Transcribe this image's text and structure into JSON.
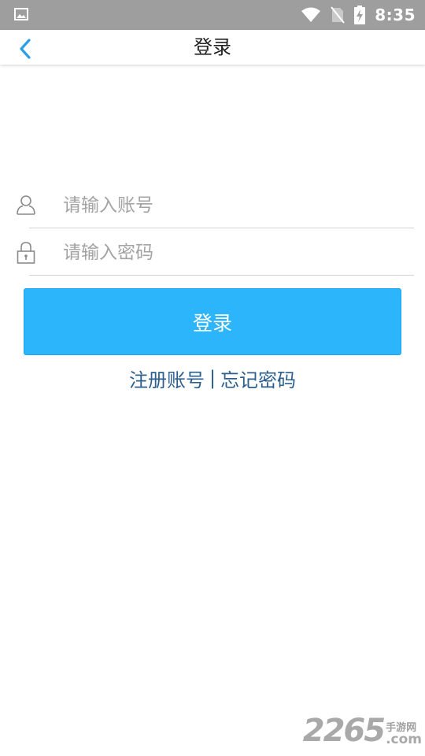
{
  "status_bar": {
    "time": "8:35",
    "icons": [
      "gallery-icon",
      "wifi-icon",
      "no-sim-icon",
      "battery-charging-icon"
    ]
  },
  "header": {
    "title": "登录",
    "back_icon": "chevron-left-icon"
  },
  "form": {
    "account": {
      "icon": "user-icon",
      "placeholder": "请输入账号",
      "value": ""
    },
    "password": {
      "icon": "lock-icon",
      "placeholder": "请输入密码",
      "value": ""
    },
    "login_label": "登录"
  },
  "links": {
    "register": "注册账号",
    "separator": "|",
    "forgot": "忘记密码"
  },
  "watermark": {
    "number": "2265",
    "site_cn": "手游网",
    "suffix": ".com"
  },
  "colors": {
    "status_bar": "#9e9e9e",
    "accent": "#2cb5fb",
    "back_arrow": "#2a9fe8",
    "link": "#2d5f8e",
    "placeholder": "#a3a3a3",
    "divider": "#d3d3d3"
  }
}
